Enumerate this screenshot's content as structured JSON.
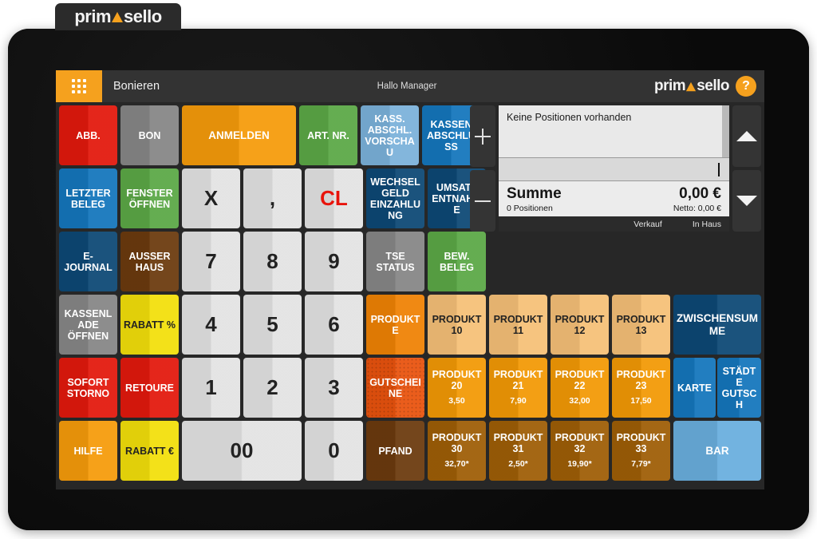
{
  "brand": {
    "name_part1": "prim",
    "name_mark": "A",
    "name_part2": "sello"
  },
  "appbar": {
    "grid_icon": "grid-icon",
    "title": "Bonieren",
    "greeting": "Hallo Manager",
    "help_label": "?"
  },
  "receipt": {
    "empty_text": "Keine Positionen vorhanden",
    "input_value": "",
    "sum_label": "Summe",
    "sum_amount": "0,00 €",
    "positions_label": "0 Positionen",
    "netto_label": "Netto: 0,00 €",
    "status_left": "Verkauf",
    "status_right": "In Haus",
    "plus_label": "+",
    "minus_label": "−",
    "scroll_up": "scroll-up",
    "scroll_down": "scroll-down"
  },
  "keys": {
    "row1": [
      {
        "name": "abbruch",
        "label": "ABB.",
        "bg": "#e2190d",
        "fg": "w",
        "size": "sm"
      },
      {
        "name": "bon",
        "label": "BON",
        "bg": "#868686",
        "fg": "w",
        "size": "sm"
      },
      {
        "name": "anmelden",
        "label": "ANMELDEN",
        "bg": "#f59b0b",
        "fg": "w",
        "size": "md"
      },
      {
        "name": "artikel-nummer",
        "label": "ART. NR.",
        "bg": "#5ba846",
        "fg": "w",
        "size": "sm"
      },
      {
        "name": "kassenabschluss-vorschau",
        "label": "KASS. ABSCHL. VORSCHAU",
        "bg": "#7bb1da",
        "fg": "w",
        "size": "sm"
      },
      {
        "name": "kassenabschluss",
        "label": "KASSEN ABSCHLUSS",
        "bg": "#1476bc",
        "fg": "w",
        "size": "sm"
      }
    ],
    "row2": [
      {
        "name": "letzter-beleg",
        "label": "LETZTER BELEG",
        "bg": "#1476bc",
        "fg": "w",
        "size": "sm"
      },
      {
        "name": "fenster-oeffnen",
        "label": "FENSTER ÖFFNEN",
        "bg": "#5ba846",
        "fg": "w",
        "size": "sm"
      },
      {
        "name": "multiply",
        "label": "X",
        "bg": "#e3e3e3",
        "fg": "d",
        "size": "num"
      },
      {
        "name": "decimal-comma",
        "label": ",",
        "bg": "#e3e3e3",
        "fg": "d",
        "size": "num"
      },
      {
        "name": "clear",
        "label": "CL",
        "bg": "#e3e3e3",
        "fg": "r",
        "size": "num"
      },
      {
        "name": "wechselgeld-einzahlung",
        "label": "WECHSELGELD EINZAHLUNG",
        "bg": "#0d4875",
        "fg": "w",
        "size": "sm"
      },
      {
        "name": "umsatz-entnahme",
        "label": "UMSATZ ENTNAHME",
        "bg": "#0d4875",
        "fg": "w",
        "size": "sm"
      }
    ],
    "row3": [
      {
        "name": "e-journal",
        "label": "E-JOURNAL",
        "bg": "#0d4875",
        "fg": "w",
        "size": "sm"
      },
      {
        "name": "ausser-haus",
        "label": "AUSSER HAUS",
        "bg": "#6b3a0e",
        "fg": "w",
        "size": "sm"
      },
      {
        "name": "digit-7",
        "label": "7",
        "bg": "#e3e3e3",
        "fg": "d",
        "size": "num"
      },
      {
        "name": "digit-8",
        "label": "8",
        "bg": "#e3e3e3",
        "fg": "d",
        "size": "num"
      },
      {
        "name": "digit-9",
        "label": "9",
        "bg": "#e3e3e3",
        "fg": "d",
        "size": "num"
      },
      {
        "name": "tse-status",
        "label": "TSE STATUS",
        "bg": "#868686",
        "fg": "w",
        "size": "sm"
      },
      {
        "name": "bew-beleg",
        "label": "BEW. BELEG",
        "bg": "#5ba846",
        "fg": "w",
        "size": "sm"
      }
    ],
    "row4": [
      {
        "name": "kassenlade-oeffnen",
        "label": "KASSENLADE ÖFFNEN",
        "bg": "#868686",
        "fg": "w",
        "size": "sm"
      },
      {
        "name": "rabatt-prozent",
        "label": "RABATT %",
        "bg": "#f2df0b",
        "fg": "d",
        "size": "sm"
      },
      {
        "name": "digit-4",
        "label": "4",
        "bg": "#e3e3e3",
        "fg": "d",
        "size": "num"
      },
      {
        "name": "digit-5",
        "label": "5",
        "bg": "#e3e3e3",
        "fg": "d",
        "size": "num"
      },
      {
        "name": "digit-6",
        "label": "6",
        "bg": "#e3e3e3",
        "fg": "d",
        "size": "num"
      },
      {
        "name": "produkte",
        "label": "PRODUKTE",
        "bg": "#ef8204",
        "fg": "w",
        "size": "sm"
      },
      {
        "name": "produkt-10",
        "label": "PRODUKT 10",
        "bg": "#f5c077",
        "fg": "d",
        "size": "sm"
      },
      {
        "name": "produkt-11",
        "label": "PRODUKT 11",
        "bg": "#f5c077",
        "fg": "d",
        "size": "sm"
      },
      {
        "name": "produkt-12",
        "label": "PRODUKT 12",
        "bg": "#f5c077",
        "fg": "d",
        "size": "sm"
      },
      {
        "name": "produkt-13",
        "label": "PRODUKT 13",
        "bg": "#f5c077",
        "fg": "d",
        "size": "sm"
      },
      {
        "name": "zwischensumme",
        "label": "ZWISCHENSUMME",
        "bg": "#0d4875",
        "fg": "w",
        "size": "md"
      }
    ],
    "row5": [
      {
        "name": "sofort-storno",
        "label": "SOFORT STORNO",
        "bg": "#e2190d",
        "fg": "w",
        "size": "sm"
      },
      {
        "name": "retoure",
        "label": "RETOURE",
        "bg": "#e2190d",
        "fg": "w",
        "size": "sm"
      },
      {
        "name": "digit-1",
        "label": "1",
        "bg": "#e3e3e3",
        "fg": "d",
        "size": "num"
      },
      {
        "name": "digit-2",
        "label": "2",
        "bg": "#e3e3e3",
        "fg": "d",
        "size": "num"
      },
      {
        "name": "digit-3",
        "label": "3",
        "bg": "#e3e3e3",
        "fg": "d",
        "size": "num"
      },
      {
        "name": "gutscheine",
        "label": "GUTSCHEINE",
        "bg": "#e9530e",
        "fg": "w",
        "size": "sm",
        "texture": true
      },
      {
        "name": "produkt-20",
        "label": "PRODUKT 20",
        "price": "3,50",
        "bg": "#f29905",
        "fg": "w",
        "size": "sm"
      },
      {
        "name": "produkt-21",
        "label": "PRODUKT 21",
        "price": "7,90",
        "bg": "#f29905",
        "fg": "w",
        "size": "sm"
      },
      {
        "name": "produkt-22",
        "label": "PRODUKT 22",
        "price": "32,00",
        "bg": "#f29905",
        "fg": "w",
        "size": "sm"
      },
      {
        "name": "produkt-23",
        "label": "PRODUKT 23",
        "price": "17,50",
        "bg": "#f29905",
        "fg": "w",
        "size": "sm"
      },
      {
        "name": "karte",
        "label": "KARTE",
        "bg": "#1476bc",
        "fg": "w",
        "size": "sm"
      },
      {
        "name": "staedte-gutschein",
        "label": "STÄDTE GUTSCH",
        "bg": "#1476bc",
        "fg": "w",
        "size": "sm"
      }
    ],
    "row6": [
      {
        "name": "hilfe",
        "label": "HILFE",
        "bg": "#f59b0b",
        "fg": "w",
        "size": "sm"
      },
      {
        "name": "rabatt-euro",
        "label": "RABATT €",
        "bg": "#f2df0b",
        "fg": "d",
        "size": "sm"
      },
      {
        "name": "digit-00",
        "label": "00",
        "bg": "#e3e3e3",
        "fg": "d",
        "size": "num"
      },
      {
        "name": "digit-0",
        "label": "0",
        "bg": "#e3e3e3",
        "fg": "d",
        "size": "num"
      },
      {
        "name": "pfand",
        "label": "PFAND",
        "bg": "#6b3a0e",
        "fg": "w",
        "size": "sm"
      },
      {
        "name": "produkt-30",
        "label": "PRODUKT 30",
        "price": "32,70*",
        "bg": "#9e5e06",
        "fg": "w",
        "size": "sm"
      },
      {
        "name": "produkt-31",
        "label": "PRODUKT 31",
        "price": "2,50*",
        "bg": "#9e5e06",
        "fg": "w",
        "size": "sm"
      },
      {
        "name": "produkt-32",
        "label": "PRODUKT 32",
        "price": "19,90*",
        "bg": "#9e5e06",
        "fg": "w",
        "size": "sm"
      },
      {
        "name": "produkt-33",
        "label": "PRODUKT 33",
        "price": "7,79*",
        "bg": "#9e5e06",
        "fg": "w",
        "size": "sm"
      },
      {
        "name": "bar",
        "label": "BAR",
        "bg": "#69aede",
        "fg": "w",
        "size": "md"
      }
    ]
  },
  "colors": {
    "accent_orange": "#f5a11e",
    "red": "#e2190d",
    "green": "#5ba846",
    "blue": "#1476bc",
    "dark_blue": "#0d4875",
    "yellow": "#f2df0b",
    "brown": "#6b3a0e",
    "gray": "#868686"
  }
}
